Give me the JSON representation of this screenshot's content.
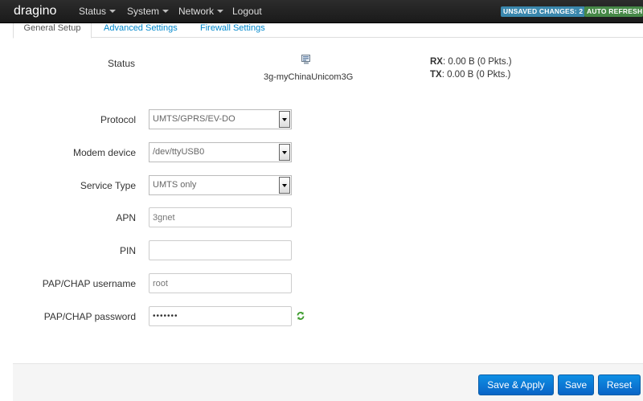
{
  "nav": {
    "brand": "dragino",
    "menu": [
      {
        "label": "Status"
      },
      {
        "label": "System"
      },
      {
        "label": "Network"
      },
      {
        "label": "Logout"
      }
    ],
    "unsaved_badge": "UNSAVED CHANGES: 2",
    "auto_refresh_badge": "AUTO REFRESH ON"
  },
  "tabs": [
    "General Setup",
    "Advanced Settings",
    "Firewall Settings"
  ],
  "status": {
    "label": "Status",
    "device_icon": "network-device-icon",
    "device_name": "3g-myChinaUnicom3G",
    "rx_label": "RX",
    "rx_value": ": 0.00 B (0 Pkts.)",
    "tx_label": "TX",
    "tx_value": ": 0.00 B (0 Pkts.)"
  },
  "form": {
    "protocol_label": "Protocol",
    "protocol_value": "UMTS/GPRS/EV-DO",
    "modem_label": "Modem device",
    "modem_value": "/dev/ttyUSB0",
    "service_label": "Service Type",
    "service_value": "UMTS only",
    "apn_label": "APN",
    "apn_value": "3gnet",
    "pin_label": "PIN",
    "pin_value": "",
    "username_label": "PAP/CHAP username",
    "username_value": "root",
    "password_label": "PAP/CHAP password",
    "password_value": "•••••••",
    "reveal_icon": "reveal-password-icon"
  },
  "actions": {
    "save_apply": "Save & Apply",
    "save": "Save",
    "reset": "Reset"
  },
  "colors": {
    "navbar": "#1f1f1f",
    "link": "#0088cc",
    "unsaved_badge": "#3a87ad",
    "auto_refresh_badge": "#468847",
    "primary_button": "#0b74d3"
  }
}
